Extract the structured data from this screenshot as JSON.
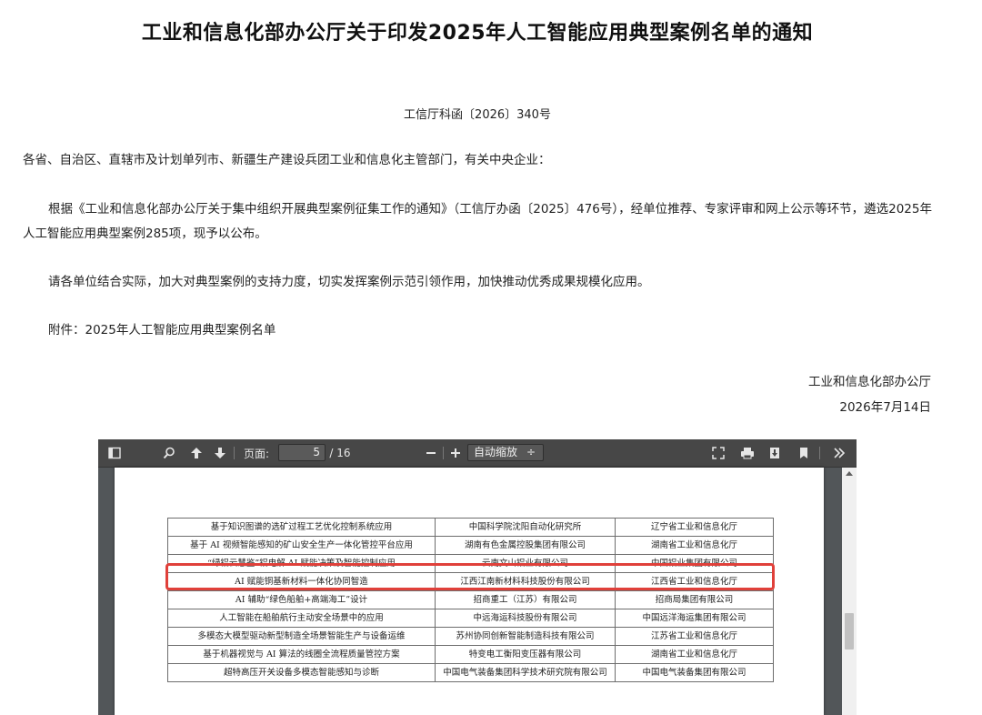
{
  "notice": {
    "title": "工业和信息化部办公厅关于印发2025年人工智能应用典型案例名单的通知",
    "doc_number": "工信厅科函〔2026〕340号",
    "addressee": "各省、自治区、直辖市及计划单列市、新疆生产建设兵团工业和信息化主管部门，有关中央企业：",
    "body_paragraph_1": "根据《工业和信息化部办公厅关于集中组织开展典型案例征集工作的通知》（工信厅办函〔2025〕476号），经单位推荐、专家评审和网上公示等环节，遴选2025年人工智能应用典型案例285项，现予以公布。",
    "body_paragraph_2": "请各单位结合实际，加大对典型案例的支持力度，切实发挥案例示范引领作用，加快推动优秀成果规模化应用。",
    "attachment": "附件：2025年人工智能应用典型案例名单",
    "signature_org": "工业和信息化部办公厅",
    "signature_date": "2026年7月14日"
  },
  "pdf_viewer": {
    "page_label": "页面:",
    "current_page": "5",
    "total_pages": "/ 16",
    "zoom_label": "自动缩放",
    "zoom_arrow": "÷",
    "icons": [
      "sidebar-toggle-icon",
      "search-icon",
      "prev-page-icon",
      "next-page-icon",
      "zoom-out-icon",
      "zoom-in-icon",
      "fullscreen-icon",
      "print-icon",
      "download-icon",
      "bookmark-icon",
      "more-tools-icon"
    ]
  },
  "case_table": {
    "rows": [
      [
        "基于知识图谱的选矿过程工艺优化控制系统应用",
        "中国科学院沈阳自动化研究所",
        "辽宁省工业和信息化厅"
      ],
      [
        "基于 AI 视频智能感知的矿山安全生产一体化管控平台应用",
        "湖南有色金属控股集团有限公司",
        "湖南省工业和信息化厅"
      ],
      [
        "“绿铝云慧鉴”铝电解 AI 赋能决策及智能控制应用",
        "云南文山铝业有限公司",
        "中国铝业集团有限公司"
      ],
      [
        "AI 赋能铜基新材料一体化协同智造",
        "江西江南新材料科技股份有限公司",
        "江西省工业和信息化厅"
      ],
      [
        "AI 辅助“绿色船舶+高端海工”设计",
        "招商重工（江苏）有限公司",
        "招商局集团有限公司"
      ],
      [
        "人工智能在船舶航行主动安全场景中的应用",
        "中远海运科技股份有限公司",
        "中国远洋海运集团有限公司"
      ],
      [
        "多模态大模型驱动新型制造全场景智能生产与设备运维",
        "苏州协同创新智能制造科技有限公司",
        "江苏省工业和信息化厅"
      ],
      [
        "基于机器视觉与 AI 算法的线圈全流程质量管控方案",
        "特变电工衡阳变压器有限公司",
        "湖南省工业和信息化厅"
      ],
      [
        "超特高压开关设备多模态智能感知与诊断",
        "中国电气装备集团科学技术研究院有限公司",
        "中国电气装备集团有限公司"
      ]
    ],
    "highlighted_row": 2,
    "highlight_color": "#e0403a"
  }
}
